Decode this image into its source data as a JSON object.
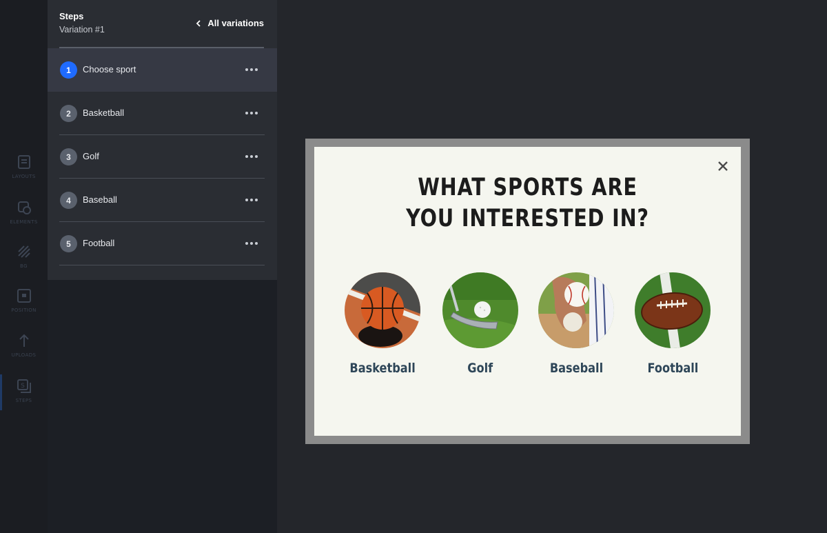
{
  "rail": {
    "items": [
      {
        "label": "LAYOUTS",
        "icon": "layouts-icon"
      },
      {
        "label": "ELEMENTS",
        "icon": "elements-icon"
      },
      {
        "label": "BG",
        "icon": "background-icon"
      },
      {
        "label": "POSITION",
        "icon": "position-icon"
      },
      {
        "label": "UPLOADS",
        "icon": "upload-icon"
      },
      {
        "label": "STEPS",
        "icon": "steps-icon"
      }
    ]
  },
  "panel": {
    "title": "Steps",
    "subtitle": "Variation #1",
    "all_variations_label": "All variations",
    "steps": [
      {
        "number": "1",
        "label": "Choose sport",
        "active": true
      },
      {
        "number": "2",
        "label": "Basketball",
        "active": false
      },
      {
        "number": "3",
        "label": "Golf",
        "active": false
      },
      {
        "number": "4",
        "label": "Baseball",
        "active": false
      },
      {
        "number": "5",
        "label": "Football",
        "active": false
      }
    ]
  },
  "popup": {
    "title_line1": "What sports are",
    "title_line2": "you interested in?",
    "close_icon": "close-icon",
    "options": [
      {
        "label": "Basketball",
        "image": "basketball-photo"
      },
      {
        "label": "Golf",
        "image": "golf-photo"
      },
      {
        "label": "Baseball",
        "image": "baseball-photo"
      },
      {
        "label": "Football",
        "image": "football-photo"
      }
    ]
  },
  "colors": {
    "active_step": "#1f6bff",
    "popup_background": "#f5f6ef",
    "option_label": "#2e4658",
    "title_text": "#1c1c1c"
  }
}
